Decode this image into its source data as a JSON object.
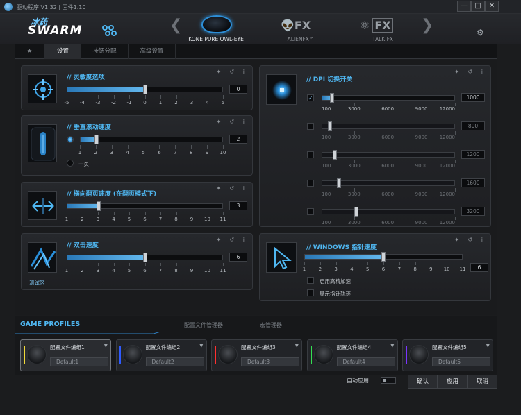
{
  "window": {
    "title": "驱动程序 V1.32 | 固件1.10",
    "minimize_icon": "—",
    "maximize_icon": "□",
    "close_icon": "✕"
  },
  "brand": {
    "cn": "冰药",
    "name": "SWARM"
  },
  "devices": [
    {
      "label": "KONE PURE OWL-EYE"
    },
    {
      "label": "ALIENFX™",
      "logo": "FX"
    },
    {
      "label": "TALK FX",
      "logo": "FX"
    }
  ],
  "nav": {
    "prev": "❮",
    "next": "❯"
  },
  "settings_icon": "⚙",
  "tabs": [
    {
      "label": "★"
    },
    {
      "label": "设置"
    },
    {
      "label": "按钮分配"
    },
    {
      "label": "高级设置"
    }
  ],
  "panel_icons": "✦ ↺ i",
  "sensitivity": {
    "title": "// 灵敏度选项",
    "labels": [
      "-5",
      "-4",
      "-3",
      "-2",
      "-1",
      "0",
      "1",
      "2",
      "3",
      "4",
      "5"
    ],
    "value": "0",
    "index": 5,
    "count": 11
  },
  "scroll": {
    "title": "// 垂直滚动速度",
    "labels": [
      "1",
      "2",
      "3",
      "4",
      "5",
      "6",
      "7",
      "8",
      "9",
      "10"
    ],
    "value": "2",
    "index": 1,
    "count": 10,
    "page_option": "一页"
  },
  "tilt": {
    "title": "// 横向翻页速度 (在翻页模式下)",
    "labels": [
      "1",
      "2",
      "3",
      "4",
      "5",
      "6",
      "7",
      "8",
      "9",
      "10",
      "11"
    ],
    "value": "3",
    "index": 2,
    "count": 11
  },
  "dblclick": {
    "title": "// 双击速度",
    "labels": [
      "1",
      "2",
      "3",
      "4",
      "5",
      "6",
      "7",
      "8",
      "9",
      "10",
      "11"
    ],
    "value": "6",
    "index": 5,
    "count": 11,
    "test_label": "测试区"
  },
  "dpi": {
    "title": "// DPI 切换开关",
    "check_glyph": "✓",
    "labels": [
      "100",
      "3000",
      "6000",
      "9000",
      "12000"
    ],
    "min": 100,
    "max": 12000,
    "rows": [
      {
        "value": "1000",
        "level": 1000,
        "checked": true
      },
      {
        "value": "800",
        "level": 800,
        "checked": false
      },
      {
        "value": "1200",
        "level": 1200,
        "checked": false
      },
      {
        "value": "1600",
        "level": 1600,
        "checked": false
      },
      {
        "value": "3200",
        "level": 3200,
        "checked": false
      }
    ]
  },
  "pointer": {
    "title": "// WINDOWS 指针速度",
    "labels": [
      "1",
      "2",
      "3",
      "4",
      "5",
      "6",
      "7",
      "8",
      "9",
      "10",
      "11"
    ],
    "value": "6",
    "index": 5,
    "count": 11,
    "opt1": "启用高精加速",
    "opt2": "显示指针轨迹"
  },
  "profiles": {
    "title": "GAME PROFILES",
    "tab_manage": "配置文件管理器",
    "tab_macro": "宏管理器",
    "caret": "▼",
    "items": [
      {
        "name": "配置文件编组1",
        "default": "Default1",
        "color": "#f0d83a"
      },
      {
        "name": "配置文件编组2",
        "default": "Default2",
        "color": "#2f5bff"
      },
      {
        "name": "配置文件编组3",
        "default": "Default3",
        "color": "#ff3030"
      },
      {
        "name": "配置文件编组4",
        "default": "Default4",
        "color": "#33e052"
      },
      {
        "name": "配置文件编组5",
        "default": "Default5",
        "color": "#7a35ff"
      }
    ]
  },
  "footer": {
    "auto_apply": "自动应用",
    "ok": "确认",
    "apply": "应用",
    "cancel": "取消"
  }
}
